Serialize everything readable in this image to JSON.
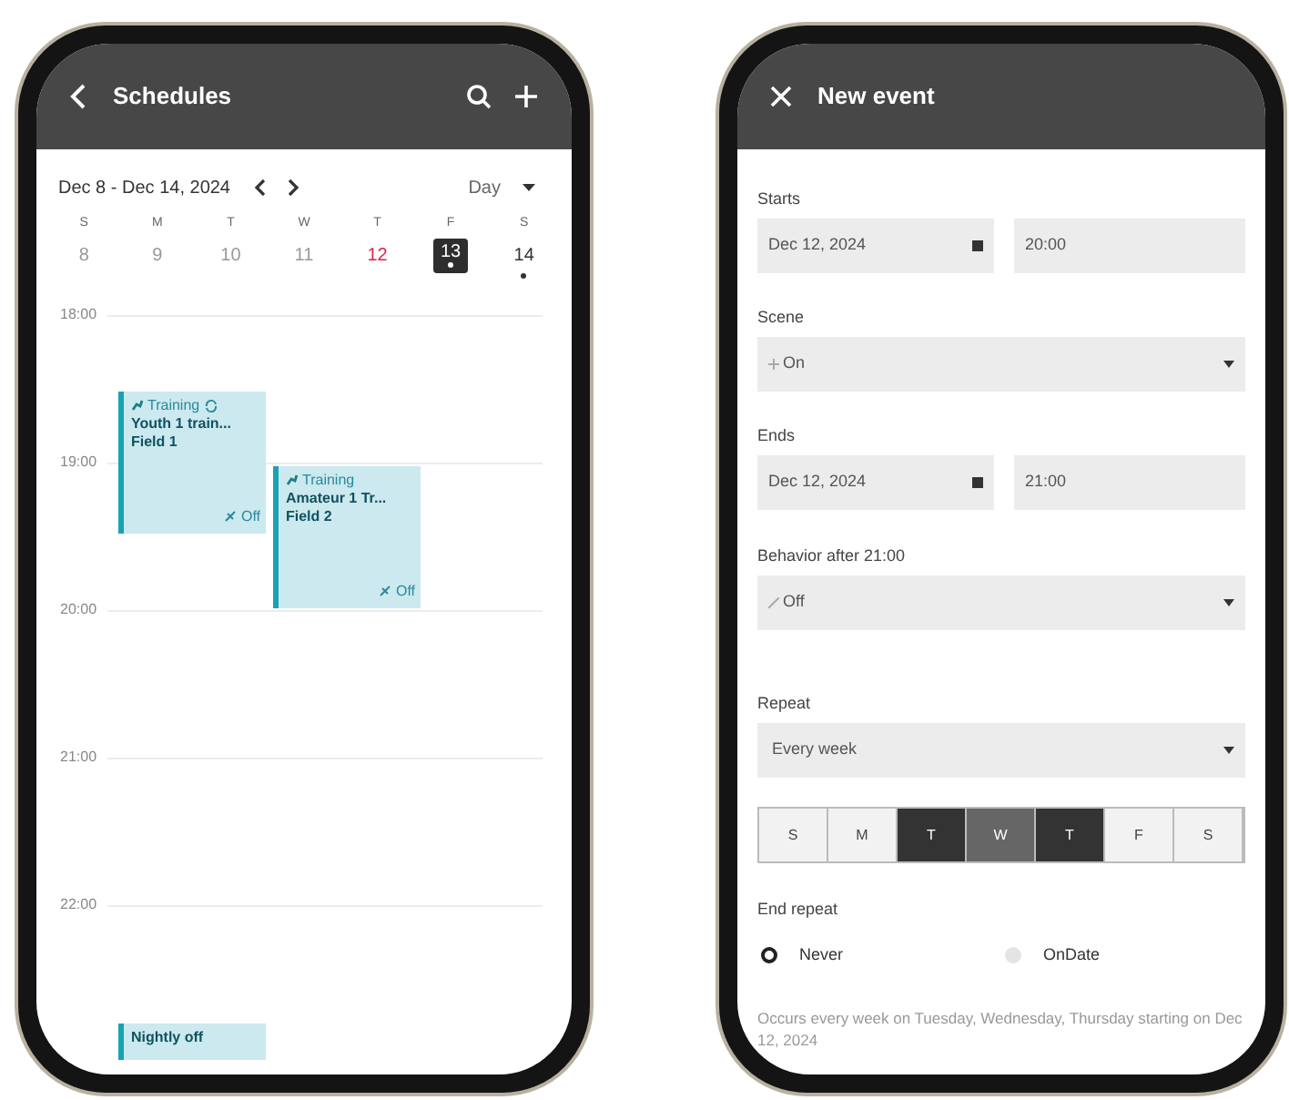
{
  "schedules": {
    "title": "Schedules",
    "range": "Dec 8 - Dec 14, 2024",
    "view": "Day",
    "days": [
      {
        "letter": "S",
        "date": "8",
        "kind": "past",
        "selected": false,
        "has_events": false
      },
      {
        "letter": "M",
        "date": "9",
        "kind": "past",
        "selected": false,
        "has_events": false
      },
      {
        "letter": "T",
        "date": "10",
        "kind": "past",
        "selected": false,
        "has_events": false
      },
      {
        "letter": "W",
        "date": "11",
        "kind": "past",
        "selected": false,
        "has_events": false
      },
      {
        "letter": "T",
        "date": "12",
        "kind": "today",
        "selected": false,
        "has_events": false
      },
      {
        "letter": "F",
        "date": "13",
        "kind": "normal",
        "selected": true,
        "has_events": true
      },
      {
        "letter": "S",
        "date": "14",
        "kind": "normal",
        "selected": false,
        "has_events": true
      }
    ],
    "hours": [
      "18:00",
      "19:00",
      "20:00",
      "21:00",
      "22:00"
    ],
    "events": [
      {
        "category": "Training",
        "recurring": true,
        "title": "Youth 1 train...",
        "location": "Field 1",
        "scene": "Off"
      },
      {
        "category": "Training",
        "recurring": false,
        "title": "Amateur 1 Tr...",
        "location": "Field 2",
        "scene": "Off"
      },
      {
        "title": "Nightly off"
      }
    ]
  },
  "new_event": {
    "title": "New event",
    "starts": {
      "label": "Starts",
      "date": "Dec 12, 2024",
      "time": "20:00"
    },
    "scene": {
      "label": "Scene",
      "value": "On"
    },
    "ends": {
      "label": "Ends",
      "date": "Dec 12, 2024",
      "time": "21:00"
    },
    "behavior": {
      "label": "Behavior after 21:00",
      "value": "Off"
    },
    "repeat": {
      "label": "Repeat",
      "value": "Every week"
    },
    "weekdays": [
      {
        "letter": "S",
        "selected": false,
        "focused": false
      },
      {
        "letter": "M",
        "selected": false,
        "focused": false
      },
      {
        "letter": "T",
        "selected": true,
        "focused": false
      },
      {
        "letter": "W",
        "selected": true,
        "focused": true
      },
      {
        "letter": "T",
        "selected": true,
        "focused": false
      },
      {
        "letter": "F",
        "selected": false,
        "focused": false
      },
      {
        "letter": "S",
        "selected": false,
        "focused": false
      }
    ],
    "end_repeat": {
      "label": "End repeat",
      "options": [
        {
          "label": "Never",
          "selected": true
        },
        {
          "label": "OnDate",
          "selected": false
        }
      ]
    },
    "summary": "Occurs every week on Tuesday, Wednesday, Thursday starting on Dec 12, 2024"
  }
}
